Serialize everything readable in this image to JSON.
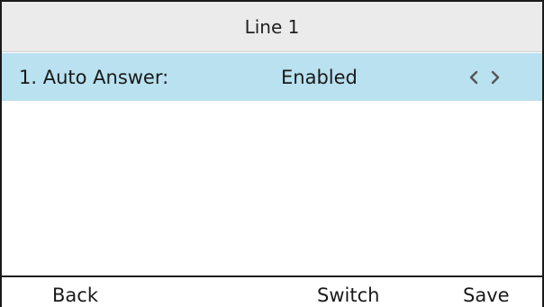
{
  "header": {
    "title": "Line 1"
  },
  "settings": [
    {
      "label": "1. Auto Answer:",
      "value": "Enabled"
    }
  ],
  "softkeys": {
    "back": "Back",
    "switch": "Switch",
    "save": "Save"
  },
  "icons": {
    "left": "chevron-left-icon",
    "right": "chevron-right-icon"
  },
  "colors": {
    "selected_row": "#b9e1ef",
    "title_bar": "#ebebeb"
  }
}
